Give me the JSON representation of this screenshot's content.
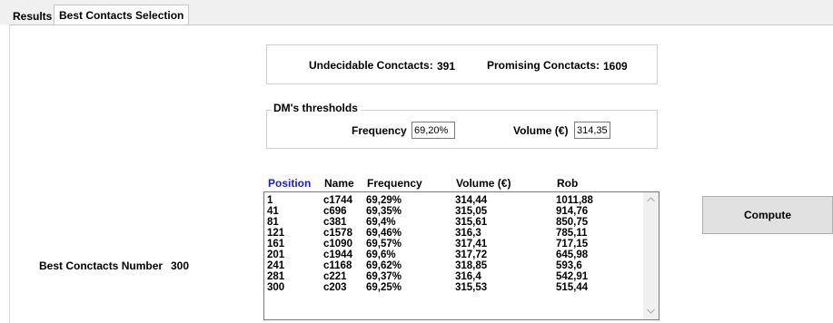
{
  "tabs": [
    {
      "label": "Results"
    },
    {
      "label": "Best Contacts Selection",
      "selected": true
    }
  ],
  "summary": {
    "undecidable_label": "Undecidable Conctacts:",
    "undecidable_value": "391",
    "promising_label": "Promising Conctacts:",
    "promising_value": "1609"
  },
  "thresholds": {
    "title": "DM's thresholds",
    "frequency_label": "Frequency",
    "frequency_value": "69,20%",
    "volume_label": "Volume (€)",
    "volume_value": "314,35"
  },
  "best_number": {
    "label": "Best Conctacts Number",
    "value": "300"
  },
  "list": {
    "headers": [
      "Position",
      "Name",
      "Frequency",
      "Volume (€)",
      "Rob"
    ],
    "rows": [
      [
        "1",
        "c1744",
        "69,29%",
        "314,44",
        "1011,88"
      ],
      [
        "41",
        "c696",
        "69,35%",
        "315,05",
        "914,76"
      ],
      [
        "81",
        "c381",
        "69,4%",
        "315,61",
        "850,75"
      ],
      [
        "121",
        "c1578",
        "69,46%",
        "316,3",
        "785,11"
      ],
      [
        "161",
        "c1090",
        "69,57%",
        "317,41",
        "717,15"
      ],
      [
        "201",
        "c1944",
        "69,6%",
        "317,72",
        "645,98"
      ],
      [
        "241",
        "c1168",
        "69,62%",
        "318,85",
        "593,6"
      ],
      [
        "281",
        "c221",
        "69,37%",
        "316,4",
        "542,91"
      ],
      [
        "300",
        "c203",
        "69,25%",
        "315,53",
        "515,44"
      ]
    ]
  },
  "compute_label": "Compute",
  "colors": {
    "position_header": "#1a1ae6",
    "tab_bg": "#f0f0f0",
    "button_bg": "#e1e1e1"
  },
  "icons": {
    "scroll_up": "chevron-up-icon",
    "scroll_down": "chevron-down-icon"
  }
}
